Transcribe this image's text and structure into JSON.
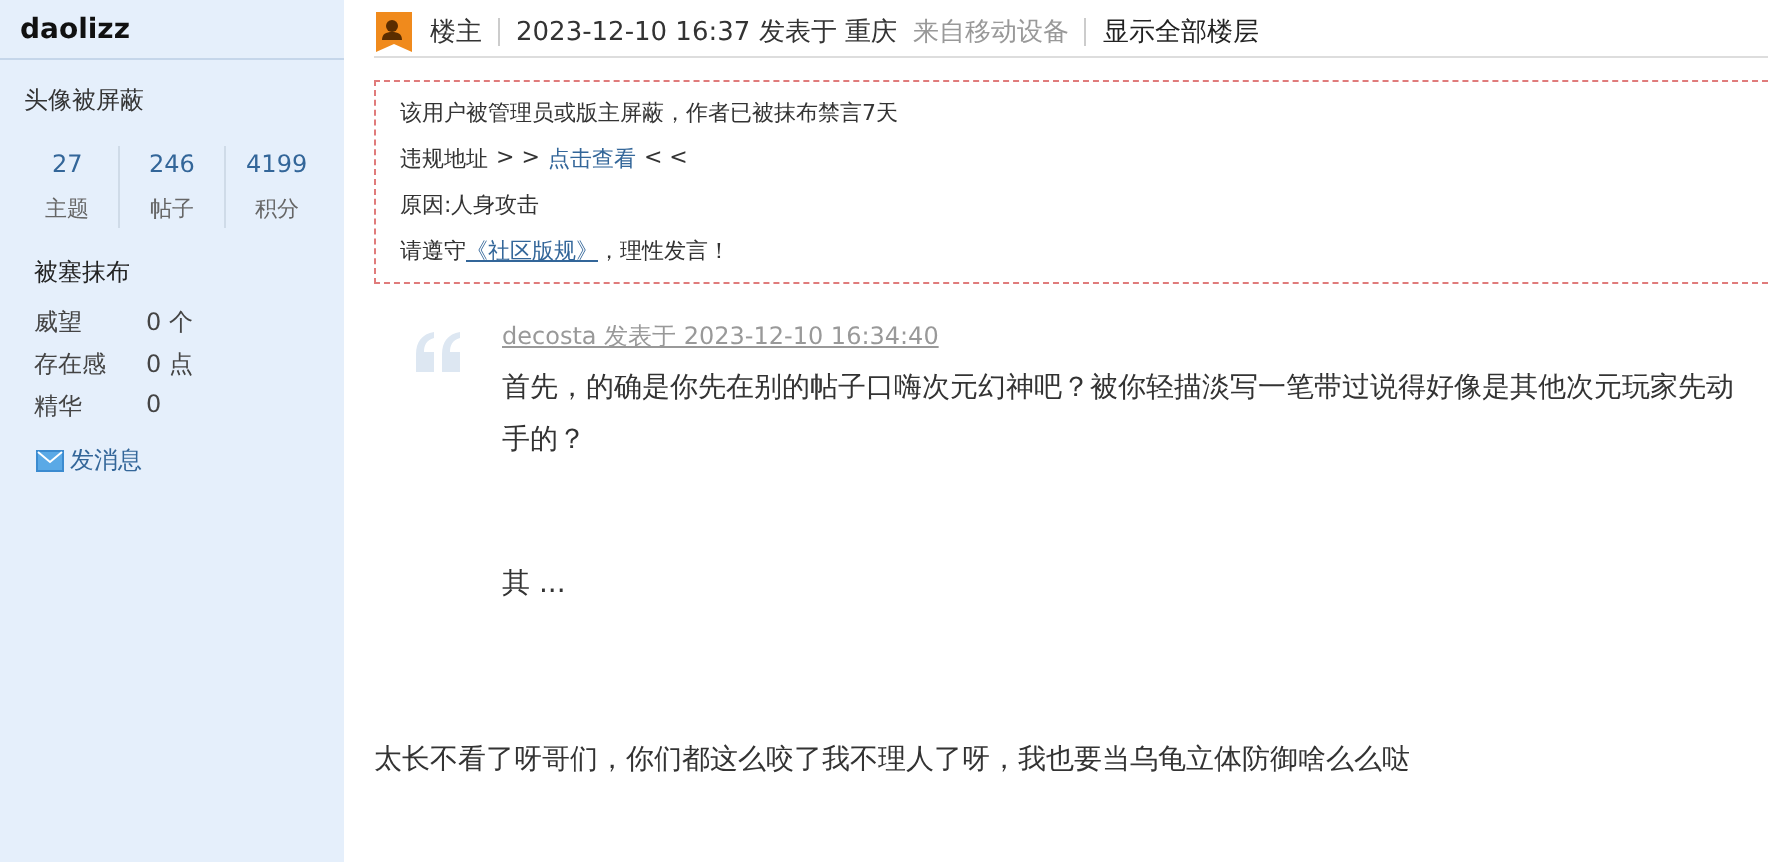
{
  "sidebar": {
    "username": "daolizz",
    "avatar_note": "头像被屏蔽",
    "stats": [
      {
        "value": "27",
        "label": "主题"
      },
      {
        "value": "246",
        "label": "帖子"
      },
      {
        "value": "4199",
        "label": "积分"
      }
    ],
    "group": "被塞抹布",
    "details": [
      {
        "label": "威望",
        "value": "0 个"
      },
      {
        "label": "存在感",
        "value": "0 点"
      },
      {
        "label": "精华",
        "value": "0"
      }
    ],
    "message_link": "发消息"
  },
  "post": {
    "badge": "楼主",
    "meta": "2023-12-10 16:37 发表于 重庆",
    "device": "来自移动设备",
    "show_all": "显示全部楼层",
    "notice": {
      "line1": "该用户被管理员或版主屏蔽，作者已被抹布禁言7天",
      "address_label": "违规地址",
      "address_open": "> >",
      "address_link": "点击查看",
      "address_close": "< <",
      "reason": "原因:人身攻击",
      "rules_before": "请遵守",
      "rules_link": "《社区版规》",
      "rules_after": "，理性发言！"
    },
    "quote": {
      "author_line": "decosta 发表于 2023-12-10 16:34:40",
      "text": "首先，的确是你先在别的帖子口嗨次元幻神吧？被你轻描淡写一笔带过说得好像是其他次元玩家先动手的？",
      "more": "其 ..."
    },
    "body": "太长不看了呀哥们，你们都这么咬了我不理人了呀，我也要当乌龟立体防御啥么么哒"
  }
}
